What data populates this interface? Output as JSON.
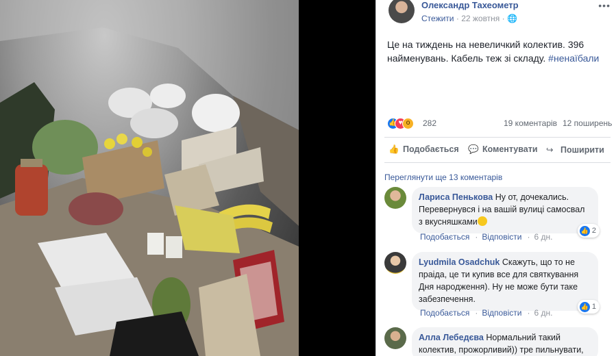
{
  "post": {
    "author": "Олександр Тахеометр",
    "follow": "Стежити",
    "date": "22 жовтня",
    "privacy_icon": "globe-icon",
    "text": "Це на тиждень на невеличкий колектив. 396 найменувань. Кабель теж зі складу. ",
    "hashtag": "#ненаїбали"
  },
  "stats": {
    "reactions": "282",
    "comments": "19 коментарів",
    "shares": "12 поширень"
  },
  "actions": {
    "like": "Подобається",
    "comment": "Коментувати",
    "share": "Поширити"
  },
  "more_comments": "Переглянути ще 13 коментарів",
  "comments": [
    {
      "author": "Лариса Пенькова",
      "text": "Ну от, дочекались. Перевернувся і на вашій вулиці самосвал з вкусняшками",
      "like": "Подобається",
      "reply": "Відповісти",
      "age": "6 дн.",
      "reactions": "2"
    },
    {
      "author": "Lyudmila Osadchuk",
      "text": "Скажуть, що то не праіда, це ти купив все для святкування Дня народження). Ну не може бути таке забезпечення.",
      "like": "Подобається",
      "reply": "Відповісти",
      "age": "6 дн.",
      "reactions": "1"
    },
    {
      "author": "Алла Лебедєва",
      "text": "Нормальний такий колектив, прожорливий)) тре пильнувати,"
    }
  ],
  "colors": {
    "link": "#385898",
    "muted": "#90949c",
    "bubble": "#f2f3f5",
    "like_blue": "#1877f2"
  }
}
